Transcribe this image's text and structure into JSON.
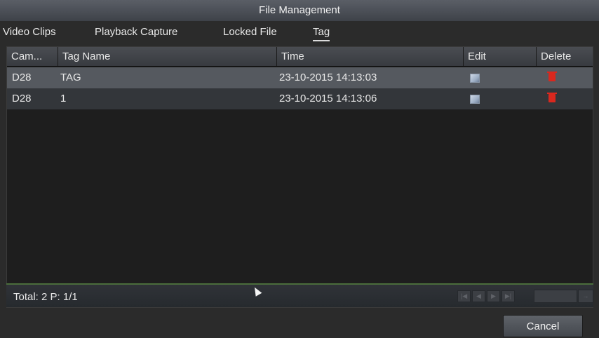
{
  "window": {
    "title": "File Management"
  },
  "tabs": [
    {
      "label": "Video Clips"
    },
    {
      "label": "Playback Capture"
    },
    {
      "label": "Locked File"
    },
    {
      "label": "Tag",
      "active": true
    }
  ],
  "table": {
    "headers": [
      "Cam...",
      "Tag Name",
      "Time",
      "Edit",
      "Delete"
    ],
    "rows": [
      {
        "camera": "D28",
        "tag_name": "TAG",
        "time": "23-10-2015 14:13:03",
        "selected": true
      },
      {
        "camera": "D28",
        "tag_name": "1",
        "time": "23-10-2015 14:13:06",
        "selected": false
      }
    ]
  },
  "footer": {
    "total": "Total: 2 P: 1/1",
    "page_input": "",
    "nav_icons": [
      "first-page-icon",
      "prev-page-icon",
      "next-page-icon",
      "last-page-icon",
      "go-icon"
    ]
  },
  "buttons": {
    "cancel": "Cancel"
  },
  "colors": {
    "selected_row": "#55595f",
    "delete_icon": "#d9281e",
    "footer_accent": "#4b6d3c"
  }
}
